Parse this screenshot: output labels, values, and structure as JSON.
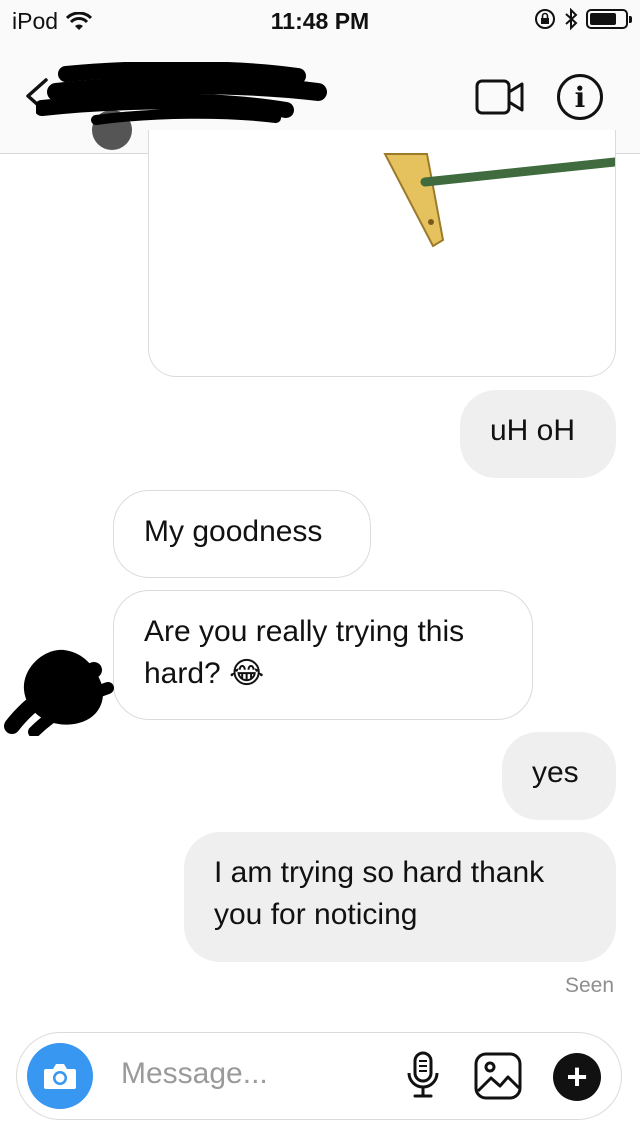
{
  "status_bar": {
    "carrier": "iPod",
    "time": "11:48 PM"
  },
  "header": {
    "back_icon": "chevron-left-icon",
    "video_icon": "video-camera-icon",
    "info_icon": "info-icon",
    "info_glyph": "i"
  },
  "messages": [
    {
      "sender": "me",
      "text": "uH oH"
    },
    {
      "sender": "them",
      "text": "My goodness"
    },
    {
      "sender": "them",
      "text": "Are you really trying this hard? 😂"
    },
    {
      "sender": "me",
      "text": "yes"
    },
    {
      "sender": "me",
      "text": "I am trying so hard thank you for noticing"
    }
  ],
  "read_receipt": "Seen",
  "composer": {
    "placeholder": "Message...",
    "plus_glyph": "+"
  },
  "colors": {
    "accent": "#3897f0",
    "my_bubble": "#efefef",
    "their_bubble_border": "#dbdbdb"
  }
}
